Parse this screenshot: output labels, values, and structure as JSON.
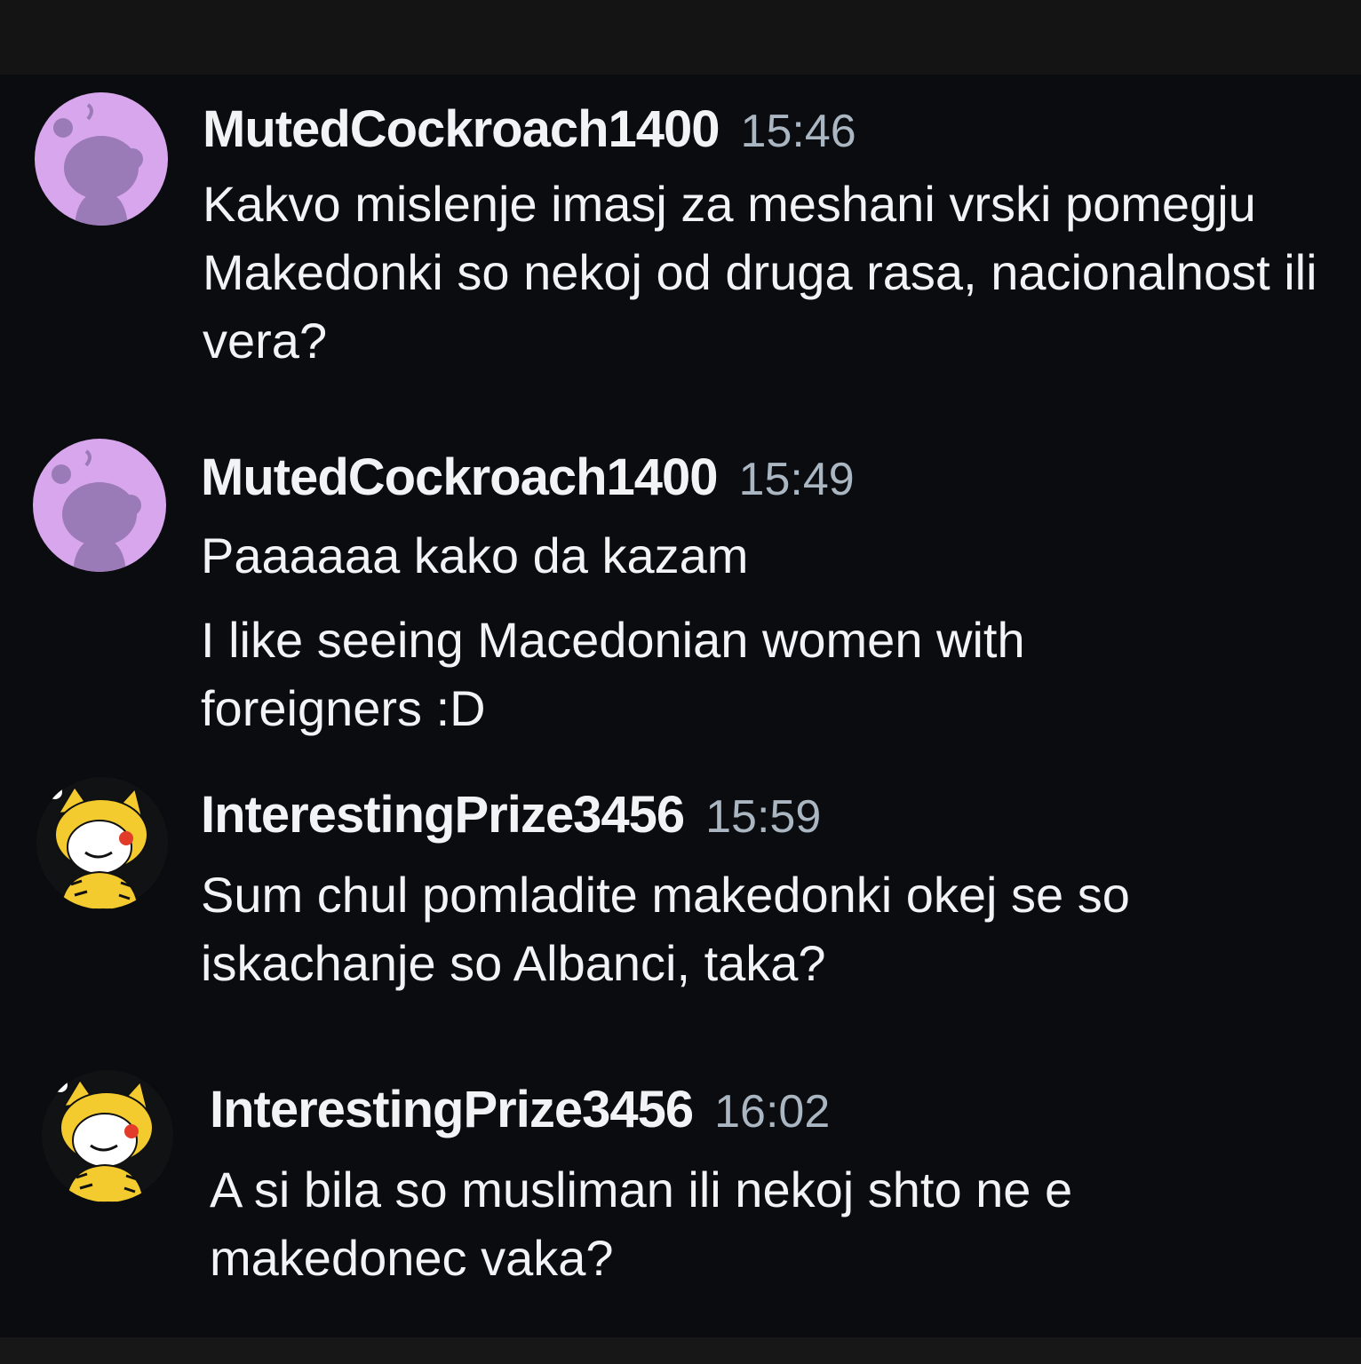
{
  "messages": [
    {
      "username": "MutedCockroach1400",
      "time": "15:46",
      "avatar_icon": "snoo-purple-avatar-icon",
      "paragraphs": [
        "Kakvo mislenje imasj za meshani vrski pomegju Makedonki so nekoj od druga rasa, nacionalnost ili vera?"
      ]
    },
    {
      "username": "MutedCockroach1400",
      "time": "15:49",
      "avatar_icon": "snoo-purple-avatar-icon",
      "paragraphs": [
        "Paaaaaa kako da kazam",
        "I like seeing Macedonian women with foreigners :D"
      ]
    },
    {
      "username": "InterestingPrize3456",
      "time": "15:59",
      "avatar_icon": "snoo-tiger-avatar-icon",
      "paragraphs": [
        "Sum chul pomladite makedonki okej se so iskachanje so Albanci, taka?"
      ]
    },
    {
      "username": "InterestingPrize3456",
      "time": "16:02",
      "avatar_icon": "snoo-tiger-avatar-icon",
      "paragraphs": [
        "A si bila so musliman ili nekoj shto ne e makedonec vaka?"
      ]
    }
  ],
  "colors": {
    "background": "#0b0c0f",
    "username": "#f1f3f5",
    "timestamp": "#aab6c2",
    "purple_avatar_bg": "#d8a6ec",
    "purple_snoo": "#9a7ab7",
    "tiger_yellow": "#f4cb2f"
  }
}
